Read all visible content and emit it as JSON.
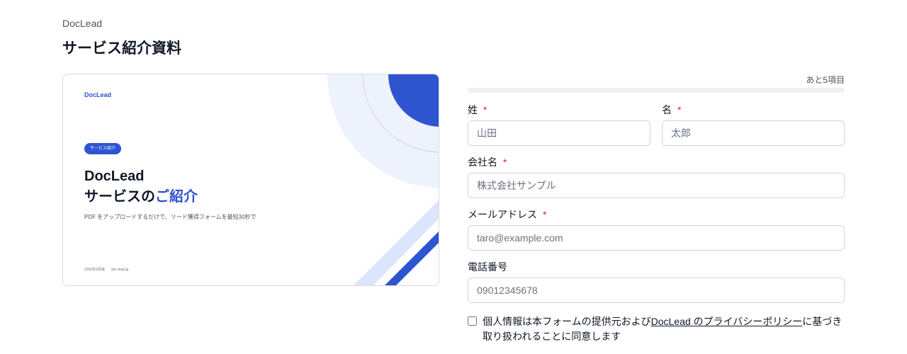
{
  "header": {
    "brand": "DocLead",
    "title": "サービス紹介資料"
  },
  "preview": {
    "logo": "DocLead",
    "badge": "サービス紹介",
    "heading_line1": "DocLead",
    "heading_line2_plain": "サービスの",
    "heading_line2_accent": "ご紹介",
    "description": "PDF をアップロードするだけで、リード獲得フォームを最短30秒で",
    "footer_date": "2026年9月版",
    "footer_site": "doc-lead.jp",
    "colors": {
      "accent": "#2f54d0",
      "light": "#eef2fd",
      "stripe": "#dbe5fb"
    }
  },
  "form": {
    "remaining": "あと5項目",
    "progress": 0,
    "last_name": {
      "label": "姓",
      "required_mark": "*",
      "placeholder": "山田"
    },
    "first_name": {
      "label": "名",
      "required_mark": "*",
      "placeholder": "太郎"
    },
    "company": {
      "label": "会社名",
      "required_mark": "*",
      "placeholder": "株式会社サンプル"
    },
    "email": {
      "label": "メールアドレス",
      "required_mark": "*",
      "placeholder": "taro@example.com"
    },
    "phone": {
      "label": "電話番号",
      "placeholder": "09012345678"
    },
    "consent": {
      "prefix": "個人情報は本フォームの提供元および",
      "link": "DocLead のプライバシーポリシー",
      "suffix": "に基づき取り扱われることに同意します"
    }
  }
}
